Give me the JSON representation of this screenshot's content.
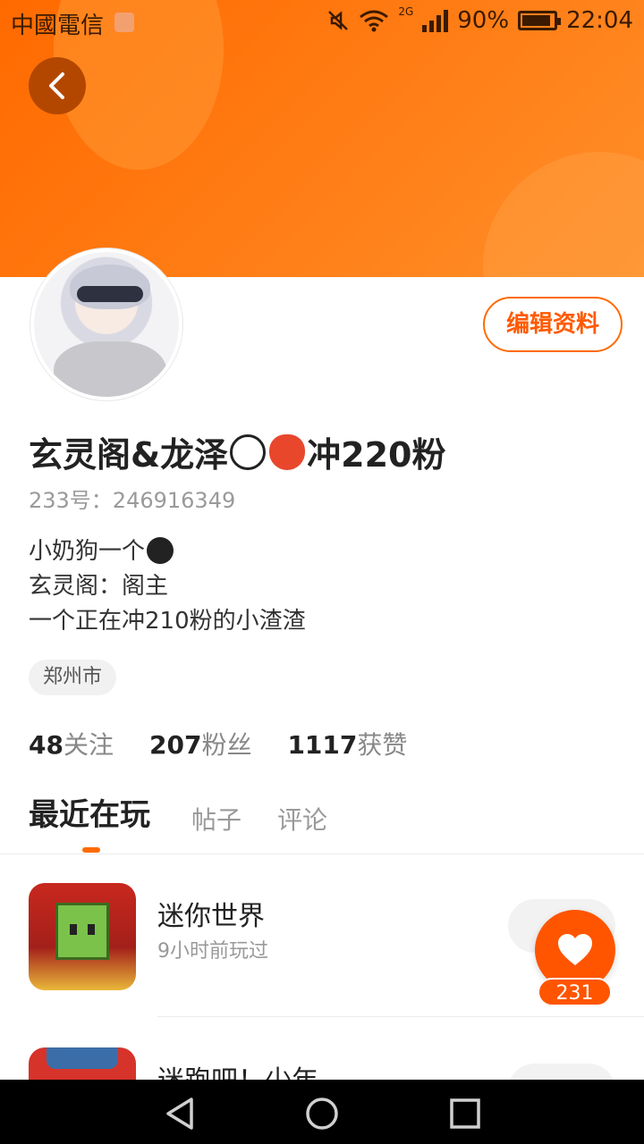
{
  "status_bar": {
    "carrier": "中國電信",
    "network": "2G",
    "battery": "90%",
    "battery_level": 0.9,
    "time": "22:04"
  },
  "header": {
    "back_icon": "chevron-left-icon"
  },
  "profile": {
    "edit_label": "编辑资料",
    "name_part1": "玄灵阁&龙泽",
    "name_part2": "冲220粉",
    "uid": "233号：246916349",
    "bio_line1": "小奶狗一个",
    "bio_line2": "玄灵阁：阁主",
    "bio_line3": "一个正在冲210粉的小渣渣",
    "location": "郑州市"
  },
  "stats": {
    "following_count": "48",
    "following_label": "关注",
    "followers_count": "207",
    "followers_label": "粉丝",
    "likes_count": "1117",
    "likes_label": "获赞"
  },
  "tabs": {
    "recent": "最近在玩",
    "posts": "帖子",
    "comments": "评论"
  },
  "games": [
    {
      "title": "迷你世界",
      "sub": "9小时前玩过"
    },
    {
      "title": "迷跑吧！少年",
      "sub": ""
    }
  ],
  "like_fab": {
    "count": "231",
    "icon": "heart-icon"
  },
  "nav_bar": {
    "back_icon": "triangle-back-icon",
    "home_icon": "circle-home-icon",
    "recents_icon": "square-recents-icon"
  },
  "colors": {
    "accent": "#ff6a00",
    "banner_start": "#ff6a00",
    "banner_end": "#ff8f2a"
  }
}
